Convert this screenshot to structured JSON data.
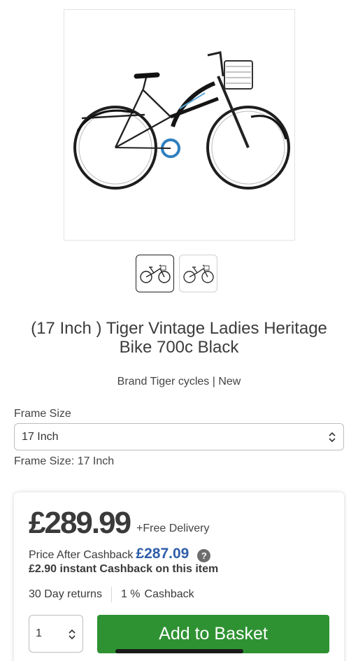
{
  "product": {
    "title": "(17 Inch ) Tiger Vintage Ladies Heritage Bike 700c Black",
    "meta": "Brand Tiger cycles | New"
  },
  "frame_size": {
    "label": "Frame Size",
    "selected": "17 Inch",
    "current_text": "Frame Size: 17 Inch"
  },
  "pricing": {
    "price": "£289.99",
    "delivery": "+Free Delivery",
    "cashback_label": "Price After Cashback",
    "cashback_price": "£287.09",
    "help_icon": "?",
    "instant_amount": "£2.90",
    "instant_text": "instant Cashback on this item",
    "returns": "30 Day returns",
    "cashback_percent": "1 %",
    "cashback_word": "Cashback"
  },
  "basket": {
    "quantity": "1",
    "add_label": "Add to Basket"
  },
  "colors": {
    "price_blue": "#2f5ea9",
    "button_green": "#2e9232"
  }
}
